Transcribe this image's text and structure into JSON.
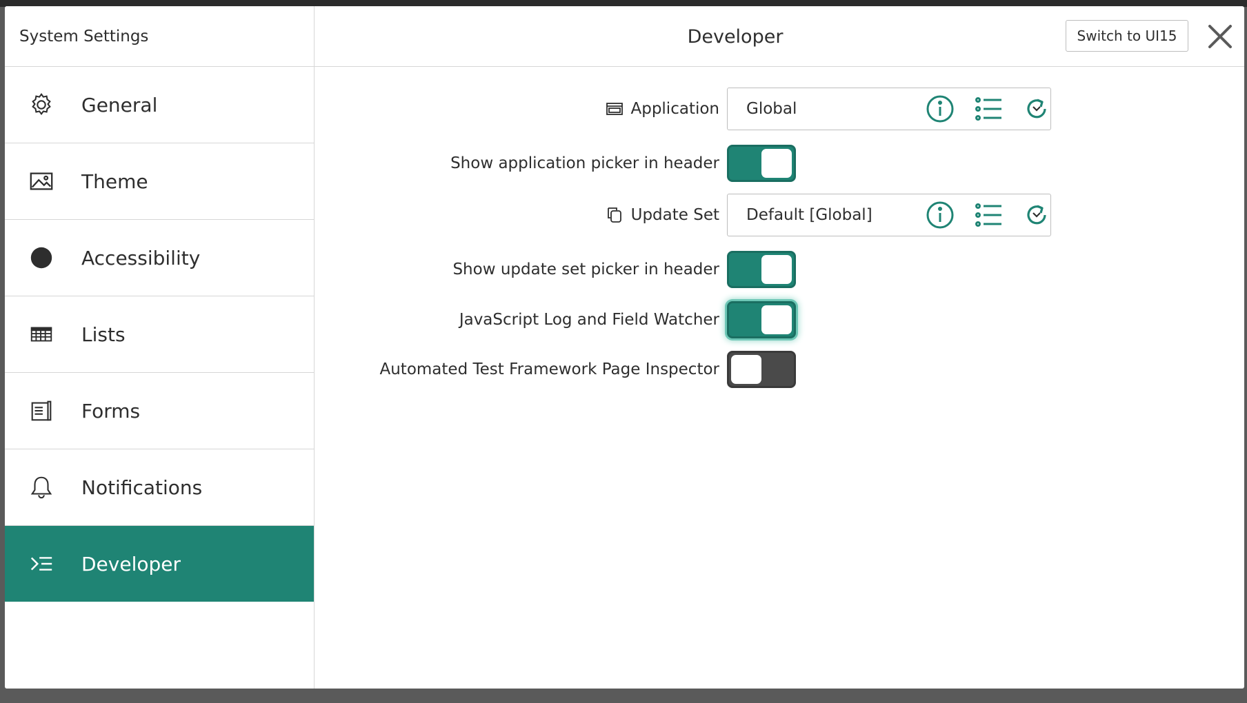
{
  "sidebar": {
    "title": "System Settings",
    "items": [
      {
        "label": "General",
        "icon": "gear-icon"
      },
      {
        "label": "Theme",
        "icon": "image-icon"
      },
      {
        "label": "Accessibility",
        "icon": "circle-icon"
      },
      {
        "label": "Lists",
        "icon": "table-icon"
      },
      {
        "label": "Forms",
        "icon": "form-icon"
      },
      {
        "label": "Notifications",
        "icon": "bell-icon"
      },
      {
        "label": "Developer",
        "icon": "developer-icon",
        "active": true
      }
    ]
  },
  "header": {
    "title": "Developer",
    "switch_label": "Switch to UI15",
    "close_icon": "close-icon"
  },
  "settings": {
    "application": {
      "label": "Application",
      "value": "Global",
      "icon": "window-icon"
    },
    "show_app_picker": {
      "label": "Show application picker in header",
      "on": true
    },
    "update_set": {
      "label": "Update Set",
      "value": "Default [Global]",
      "icon": "copy-icon"
    },
    "show_update_set_picker": {
      "label": "Show update set picker in header",
      "on": true
    },
    "js_log": {
      "label": "JavaScript Log and Field Watcher",
      "on": true
    },
    "atf_inspector": {
      "label": "Automated Test Framework Page Inspector",
      "on": false
    }
  },
  "colors": {
    "accent": "#1f8474",
    "toggle_off": "#4a4a4a"
  }
}
